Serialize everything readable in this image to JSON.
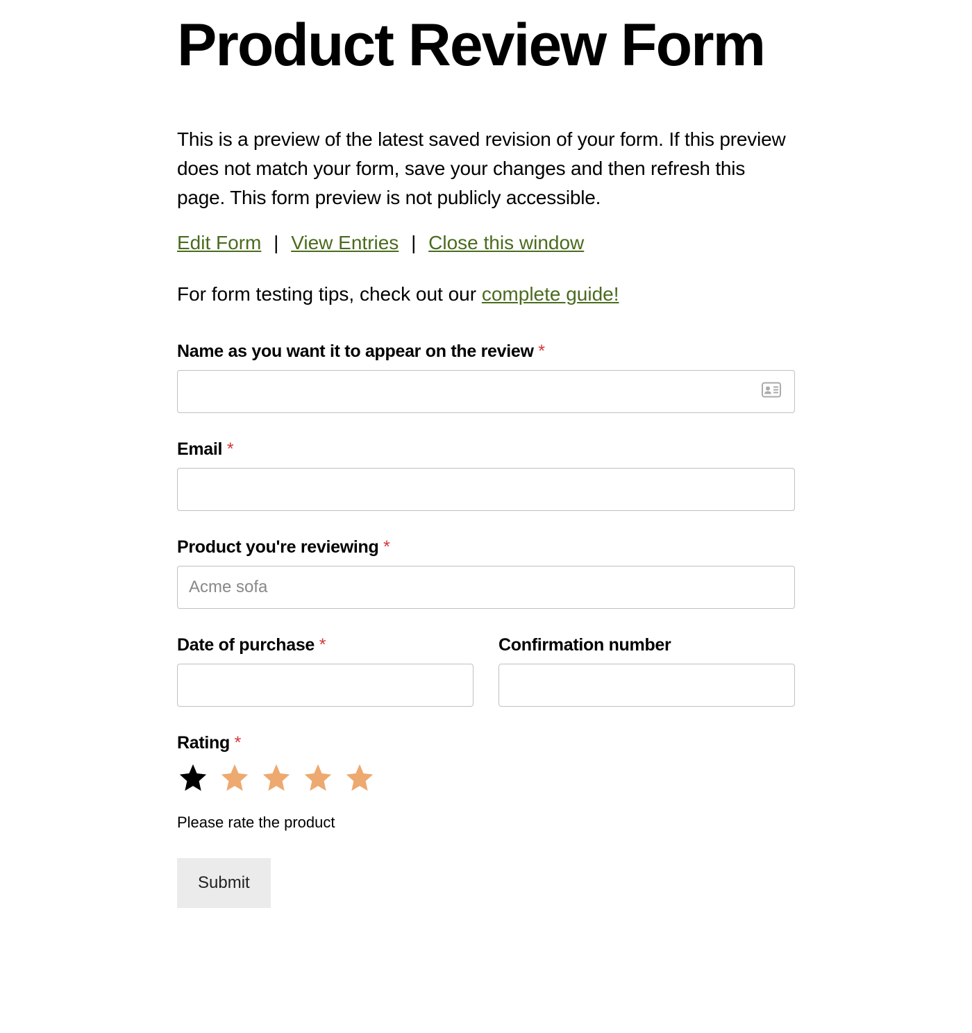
{
  "title": "Product Review Form",
  "intro": "This is a preview of the latest saved revision of your form. If this preview does not match your form, save your changes and then refresh this page. This form preview is not publicly accessible.",
  "links": {
    "edit": "Edit Form",
    "entries": "View Entries",
    "close": "Close this window"
  },
  "tips_prefix": "For form testing tips, check out our ",
  "tips_link": "complete guide!",
  "fields": {
    "name": {
      "label": "Name as you want it to appear on the review",
      "required": "*"
    },
    "email": {
      "label": "Email",
      "required": "*"
    },
    "product": {
      "label": "Product you're reviewing",
      "required": "*",
      "placeholder": "Acme sofa"
    },
    "date": {
      "label": "Date of purchase",
      "required": "*"
    },
    "confirmation": {
      "label": "Confirmation number"
    },
    "rating": {
      "label": "Rating",
      "required": "*",
      "help": "Please rate the product"
    }
  },
  "submit": "Submit"
}
